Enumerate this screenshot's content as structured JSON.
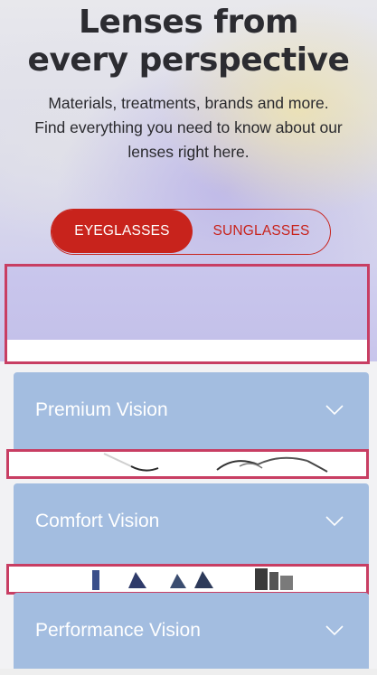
{
  "hero": {
    "title_line1": "Lenses from",
    "title_line2": "every perspective",
    "subtitle_line1": "Materials, treatments, brands and more.",
    "subtitle_line2": "Find everything you need to know about our",
    "subtitle_line3": "lenses right here."
  },
  "toggle": {
    "options": [
      "EYEGLASSES",
      "SUNGLASSES"
    ],
    "selected": "EYEGLASSES"
  },
  "cards": [
    {
      "title": "Premium Vision",
      "icon": "chevron-down-icon"
    },
    {
      "title": "Comfort Vision",
      "icon": "chevron-down-icon"
    },
    {
      "title": "Performance Vision",
      "icon": "chevron-down-icon"
    }
  ],
  "colors": {
    "brand_red": "#c8231c",
    "card_blue": "#a3bde0",
    "highlight": "#c83e63",
    "title_text": "#2c2c31"
  }
}
